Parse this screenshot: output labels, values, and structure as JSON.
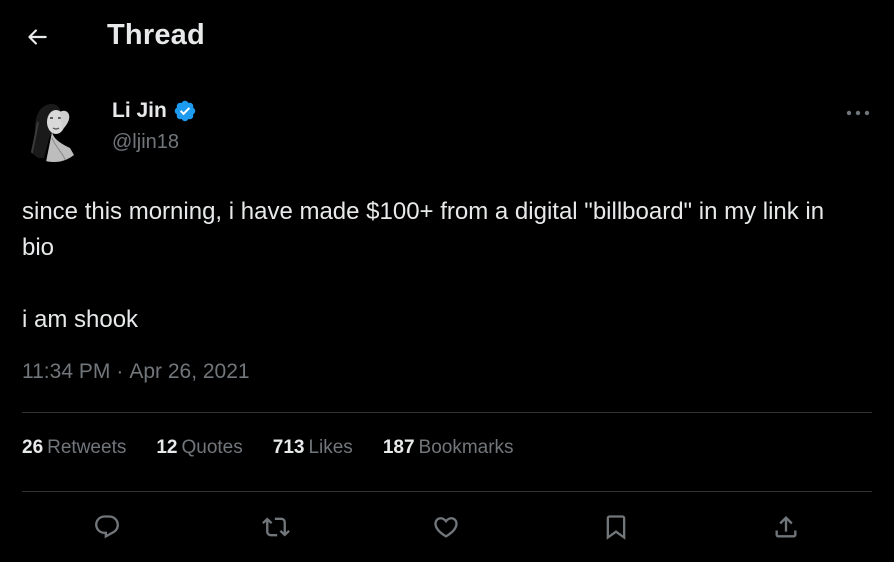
{
  "header": {
    "title": "Thread",
    "back_icon": "arrow-left-icon"
  },
  "author": {
    "name": "Li Jin",
    "handle": "@ljin18",
    "verified": true,
    "verified_color": "#1d9bf0"
  },
  "tweet": {
    "paragraphs": [
      "since this morning, i have made $100+ from a digital \"billboard\" in my link in bio",
      "i am shook"
    ],
    "time": "11:34 PM",
    "date": "Apr 26, 2021"
  },
  "stats": {
    "retweets": {
      "count": "26",
      "label": "Retweets"
    },
    "quotes": {
      "count": "12",
      "label": "Quotes"
    },
    "likes": {
      "count": "713",
      "label": "Likes"
    },
    "bookmarks": {
      "count": "187",
      "label": "Bookmarks"
    }
  },
  "actions": [
    {
      "name": "reply",
      "icon": "reply-icon"
    },
    {
      "name": "retweet",
      "icon": "retweet-icon"
    },
    {
      "name": "like",
      "icon": "heart-icon"
    },
    {
      "name": "bookmark",
      "icon": "bookmark-icon"
    },
    {
      "name": "share",
      "icon": "share-icon"
    }
  ],
  "colors": {
    "background": "#000000",
    "text_primary": "#e7e9ea",
    "text_secondary": "#71767b",
    "divider": "#2f3336",
    "accent": "#1d9bf0"
  }
}
